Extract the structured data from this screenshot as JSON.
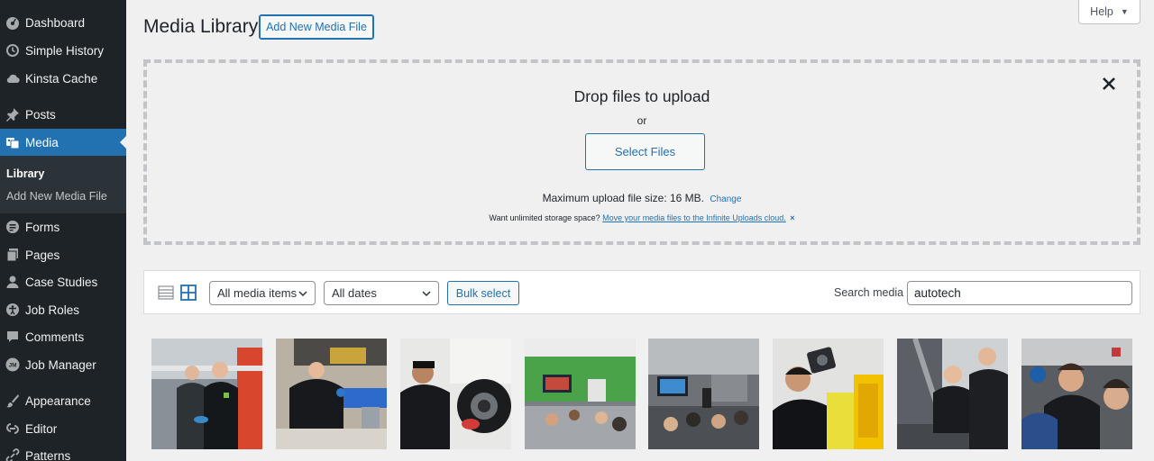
{
  "sidebar": {
    "items": [
      {
        "label": "Dashboard",
        "icon": "dashboard-icon"
      },
      {
        "label": "Simple History",
        "icon": "history-icon"
      },
      {
        "label": "Kinsta Cache",
        "icon": "cloud-icon"
      },
      {
        "label": "Posts",
        "icon": "pin-icon"
      },
      {
        "label": "Media",
        "icon": "media-icon"
      },
      {
        "label": "Forms",
        "icon": "forms-icon"
      },
      {
        "label": "Pages",
        "icon": "pages-icon"
      },
      {
        "label": "Case Studies",
        "icon": "user-icon"
      },
      {
        "label": "Job Roles",
        "icon": "accessibility-icon"
      },
      {
        "label": "Comments",
        "icon": "comment-icon"
      },
      {
        "label": "Job Manager",
        "icon": "jm-icon"
      },
      {
        "label": "Appearance",
        "icon": "brush-icon"
      },
      {
        "label": "Editor",
        "icon": "editor-icon"
      },
      {
        "label": "Patterns",
        "icon": "link-icon"
      }
    ],
    "submenu": {
      "library": "Library",
      "add_new": "Add New Media File"
    },
    "jm_badge": "JM"
  },
  "header": {
    "title": "Media Library",
    "add_new_label": "Add New Media File",
    "help_label": "Help"
  },
  "uploader": {
    "title": "Drop files to upload",
    "or": "or",
    "select_files": "Select Files",
    "max_size": "Maximum upload file size: 16 MB.",
    "change": "Change",
    "promo_text": "Want unlimited storage space?",
    "promo_link": "Move your media files to the Infinite Uploads cloud.",
    "promo_close": "×"
  },
  "toolbar": {
    "filter_type": "All media items",
    "filter_date": "All dates",
    "bulk_select": "Bulk select",
    "search_label": "Search media",
    "search_value": "autotech"
  },
  "colors": {
    "accent": "#2271b1",
    "sidebar": "#1d2327",
    "background": "#f0f0f1"
  }
}
